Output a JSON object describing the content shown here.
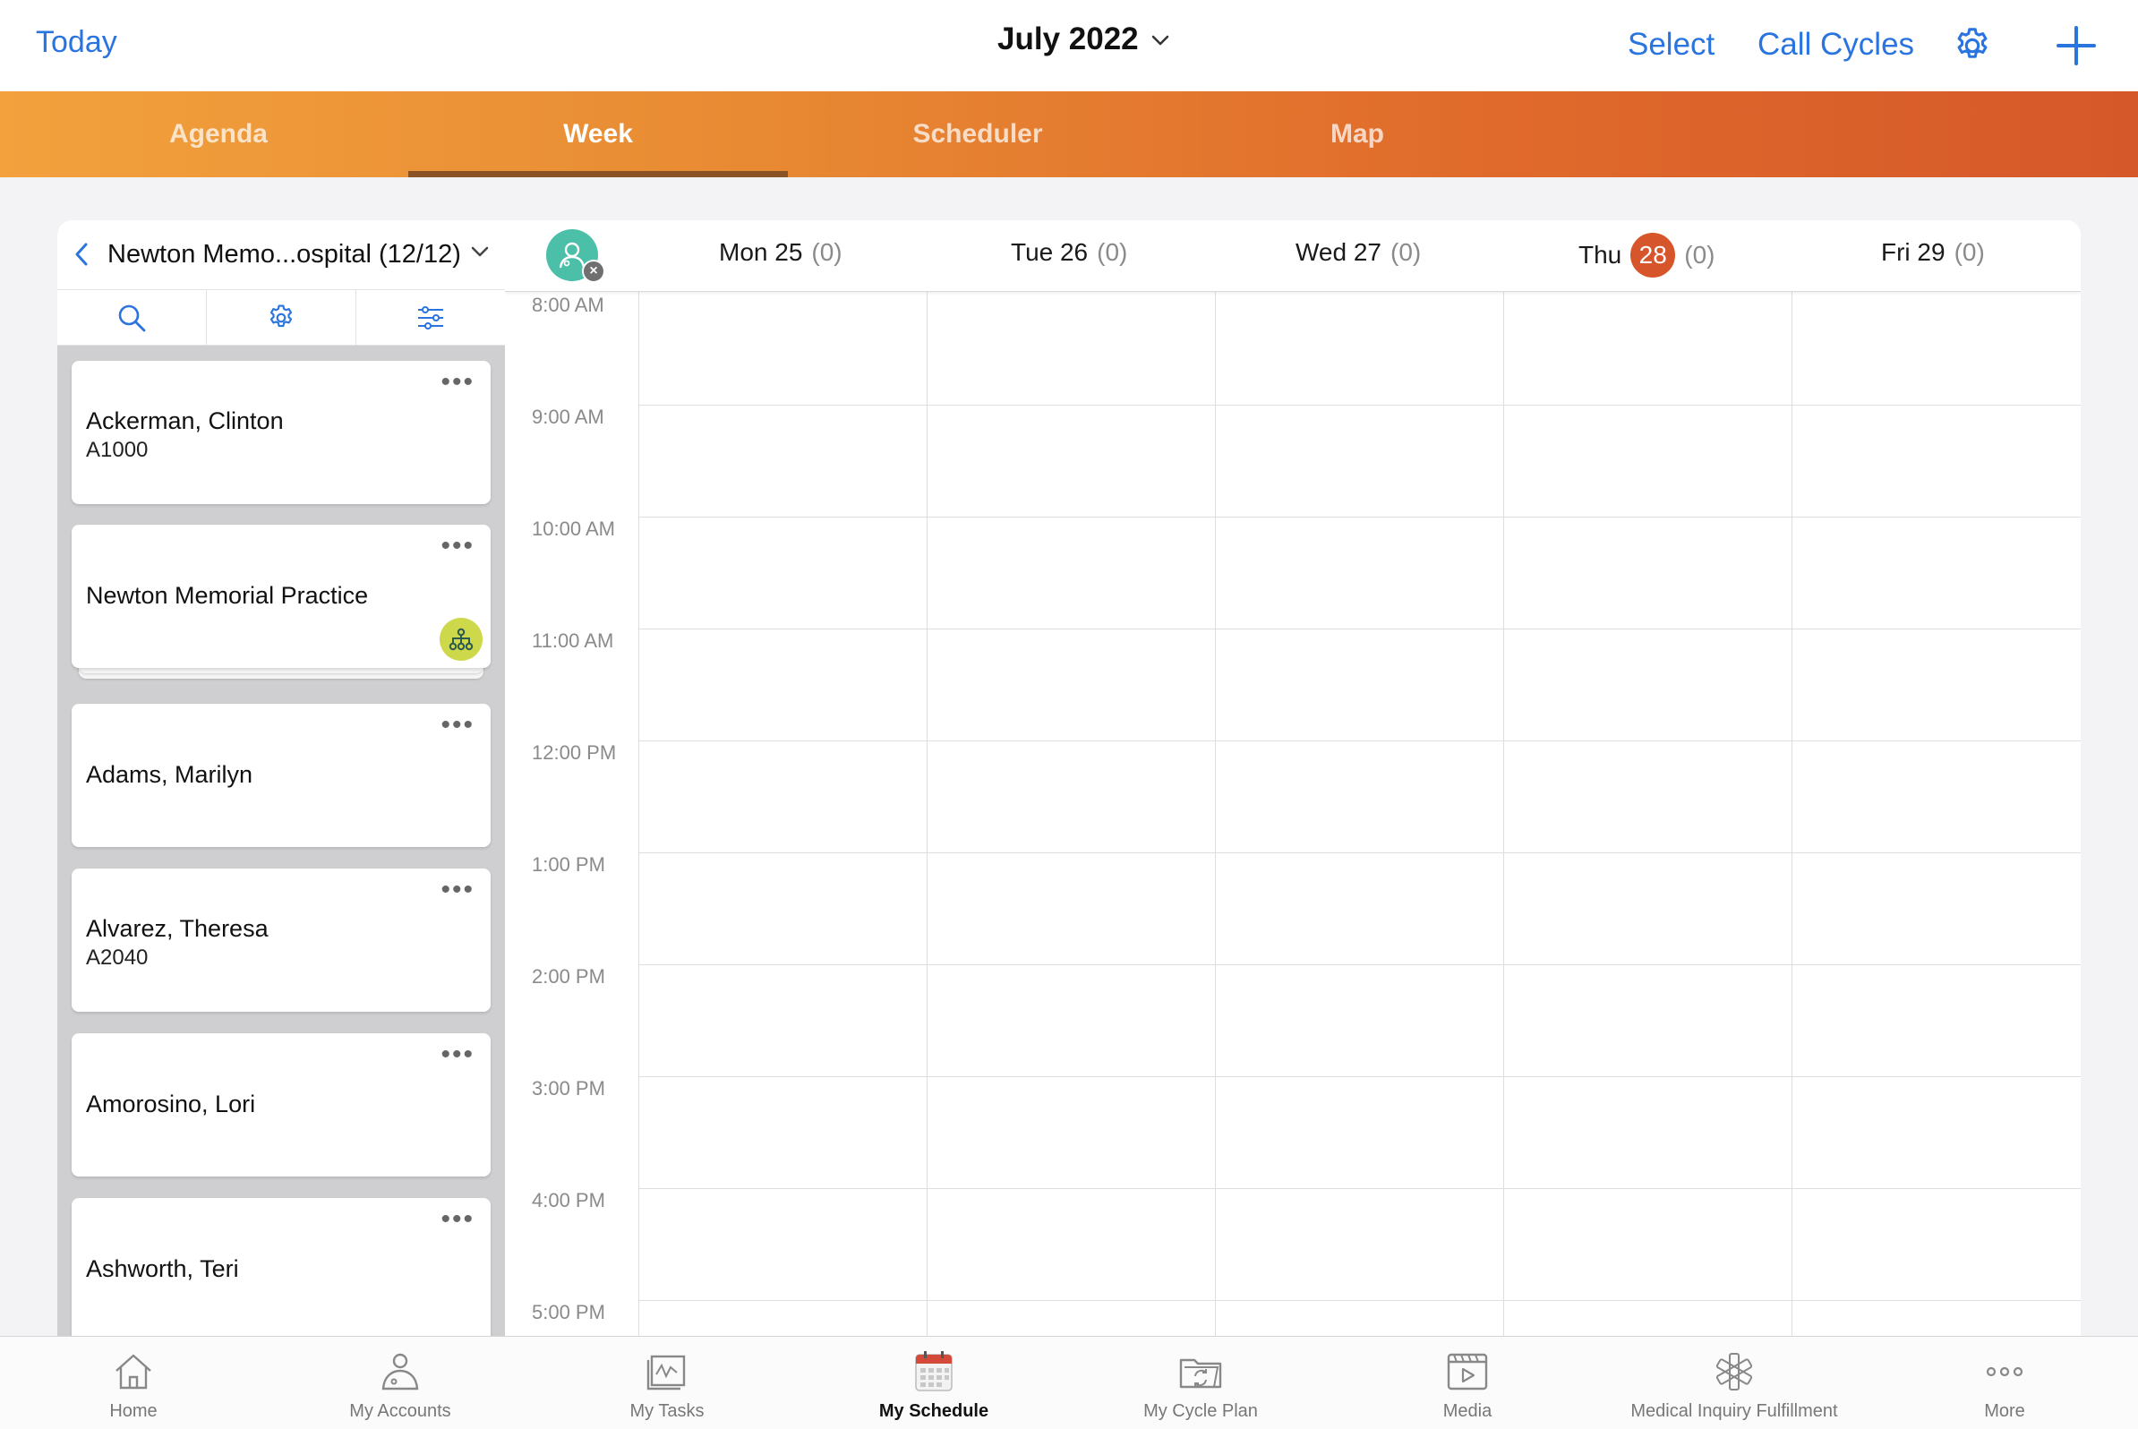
{
  "header": {
    "today_label": "Today",
    "month_title": "July 2022",
    "select_label": "Select",
    "call_cycles_label": "Call Cycles",
    "settings_icon": "gear-icon",
    "add_icon": "plus-icon",
    "accent_color": "#2a74e0"
  },
  "tabs": [
    {
      "label": "Agenda",
      "active": false
    },
    {
      "label": "Week",
      "active": true
    },
    {
      "label": "Scheduler",
      "active": false
    },
    {
      "label": "Map",
      "active": false
    }
  ],
  "account_panel": {
    "title": "Newton Memo...ospital (12/12)",
    "tools": [
      "search-icon",
      "gear-icon",
      "sliders-icon"
    ],
    "cards": [
      {
        "name": "Ackerman, Clinton",
        "id": "A1000"
      },
      {
        "name": "Newton Memorial Practice",
        "id": "",
        "badge": "hierarchy-icon"
      },
      {
        "name": "Adams, Marilyn",
        "id": ""
      },
      {
        "name": "Alvarez, Theresa",
        "id": "A2040"
      },
      {
        "name": "Amorosino, Lori",
        "id": ""
      },
      {
        "name": "Ashworth, Teri",
        "id": ""
      }
    ]
  },
  "calendar": {
    "days": [
      {
        "label": "Mon 25",
        "count": "(0)",
        "is_today": false
      },
      {
        "label": "Tue 26",
        "count": "(0)",
        "is_today": false
      },
      {
        "label": "Wed 27",
        "count": "(0)",
        "is_today": false
      },
      {
        "label": "Thu",
        "day_number": "28",
        "count": "(0)",
        "is_today": true
      },
      {
        "label": "Fri 29",
        "count": "(0)",
        "is_today": false
      }
    ],
    "times": [
      "8:00 AM",
      "9:00 AM",
      "10:00 AM",
      "11:00 AM",
      "12:00 PM",
      "1:00 PM",
      "2:00 PM",
      "3:00 PM",
      "4:00 PM",
      "5:00 PM"
    ],
    "today_color": "#d6552a"
  },
  "bottom_tabs": [
    {
      "label": "Home",
      "icon": "home-icon",
      "active": false
    },
    {
      "label": "My Accounts",
      "icon": "accounts-icon",
      "active": false
    },
    {
      "label": "My Tasks",
      "icon": "tasks-icon",
      "active": false
    },
    {
      "label": "My Schedule",
      "icon": "calendar-icon",
      "active": true
    },
    {
      "label": "My Cycle Plan",
      "icon": "cycle-plan-icon",
      "active": false
    },
    {
      "label": "Media",
      "icon": "media-icon",
      "active": false
    },
    {
      "label": "Medical Inquiry Fulfillment",
      "icon": "medical-icon",
      "active": false
    },
    {
      "label": "More",
      "icon": "more-icon",
      "active": false
    }
  ]
}
